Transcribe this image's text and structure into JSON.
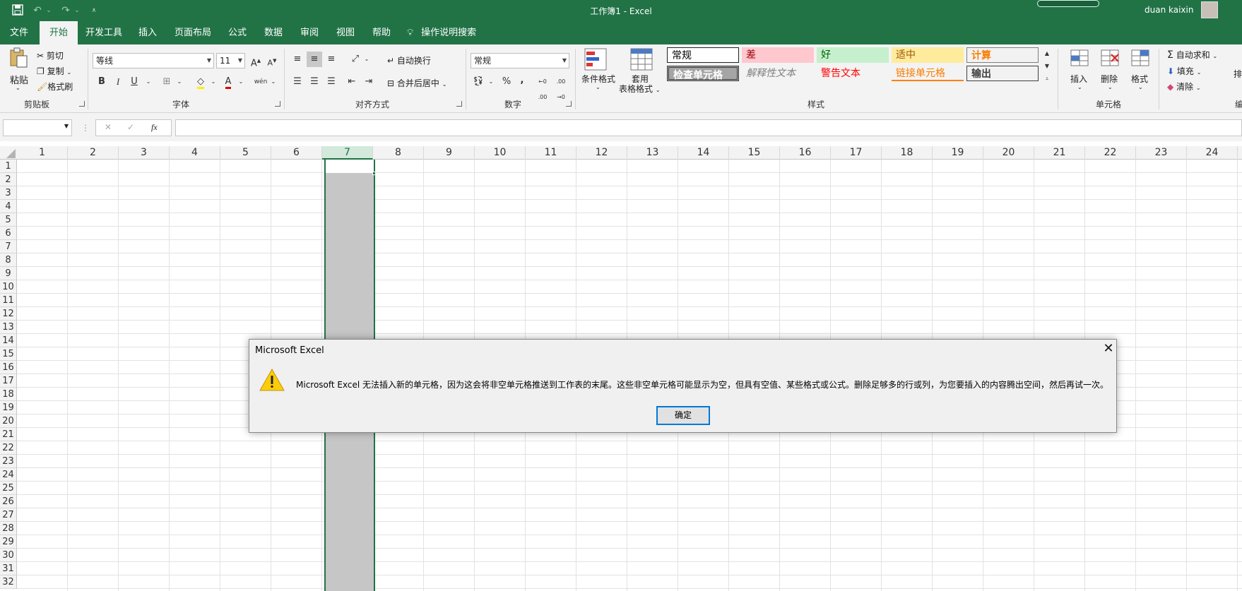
{
  "window": {
    "title": "工作簿1  -  Excel",
    "user": "duan kaixin"
  },
  "quick_access": {
    "save_icon": "save-icon",
    "undo_icon": "undo-icon",
    "redo_icon": "redo-icon",
    "customize_icon": "customize-icon"
  },
  "tabs": [
    {
      "label": "文件"
    },
    {
      "label": "开始"
    },
    {
      "label": "开发工具"
    },
    {
      "label": "插入"
    },
    {
      "label": "页面布局"
    },
    {
      "label": "公式"
    },
    {
      "label": "数据"
    },
    {
      "label": "审阅"
    },
    {
      "label": "视图"
    },
    {
      "label": "帮助"
    }
  ],
  "tell_me": "操作说明搜索",
  "clipboard": {
    "paste": "粘贴",
    "cut": "剪切",
    "copy": "复制",
    "format_painter": "格式刷",
    "group": "剪贴板"
  },
  "font": {
    "name": "等线",
    "size": "11",
    "group": "字体",
    "bold": "B",
    "italic": "I",
    "underline": "U",
    "grow": "A",
    "shrink": "A",
    "phonetic": "wén"
  },
  "alignment": {
    "wrap": "自动换行",
    "merge": "合并后居中",
    "group": "对齐方式"
  },
  "number": {
    "format": "常规",
    "percent": "%",
    "comma": ",",
    "inc_dec": "←0 .00",
    "dec_dec": ".00 →0",
    "group": "数字"
  },
  "styles": {
    "conditional": "条件格式",
    "table_line1": "套用",
    "table_line2": "表格格式",
    "cells": [
      "常规",
      "差",
      "好",
      "适中",
      "计算",
      "检查单元格",
      "解释性文本",
      "警告文本",
      "链接单元格",
      "输出"
    ],
    "group": "样式"
  },
  "cells_group": {
    "insert": "插入",
    "delete": "删除",
    "format": "格式",
    "group": "单元格"
  },
  "editing": {
    "autosum": "自动求和",
    "fill": "填充",
    "clear": "清除",
    "sort_partial": "排",
    "group_partial": "编"
  },
  "formula_bar": {
    "cancel": "✕",
    "enter": "✓",
    "fx": "fx",
    "value": ""
  },
  "columns": [
    "1",
    "2",
    "3",
    "4",
    "5",
    "6",
    "7",
    "8",
    "9",
    "10",
    "11",
    "12",
    "13",
    "14",
    "15",
    "16",
    "17",
    "18",
    "19",
    "20",
    "21",
    "22",
    "23",
    "24"
  ],
  "rows": [
    "1",
    "2",
    "3",
    "4",
    "5",
    "6",
    "7",
    "8",
    "9",
    "10",
    "11",
    "12",
    "13",
    "14",
    "15",
    "16",
    "17",
    "18",
    "19",
    "20",
    "21",
    "22",
    "23",
    "24",
    "25",
    "26",
    "27",
    "28",
    "29",
    "30",
    "31",
    "32"
  ],
  "selected_column": "7",
  "dialog": {
    "title": "Microsoft Excel",
    "message": "Microsoft Excel 无法插入新的单元格，因为这会将非空单元格推送到工作表的末尾。这些非空单元格可能显示为空，但具有空值、某些格式或公式。删除足够多的行或列，为您要插入的内容腾出空间，然后再试一次。",
    "ok": "确定",
    "icon": "warning-icon"
  },
  "colors": {
    "excel_green": "#217346",
    "selection_gray": "#c6c6c6",
    "dialog_bg": "#f0f0f0",
    "focus_blue": "#0078d7"
  }
}
